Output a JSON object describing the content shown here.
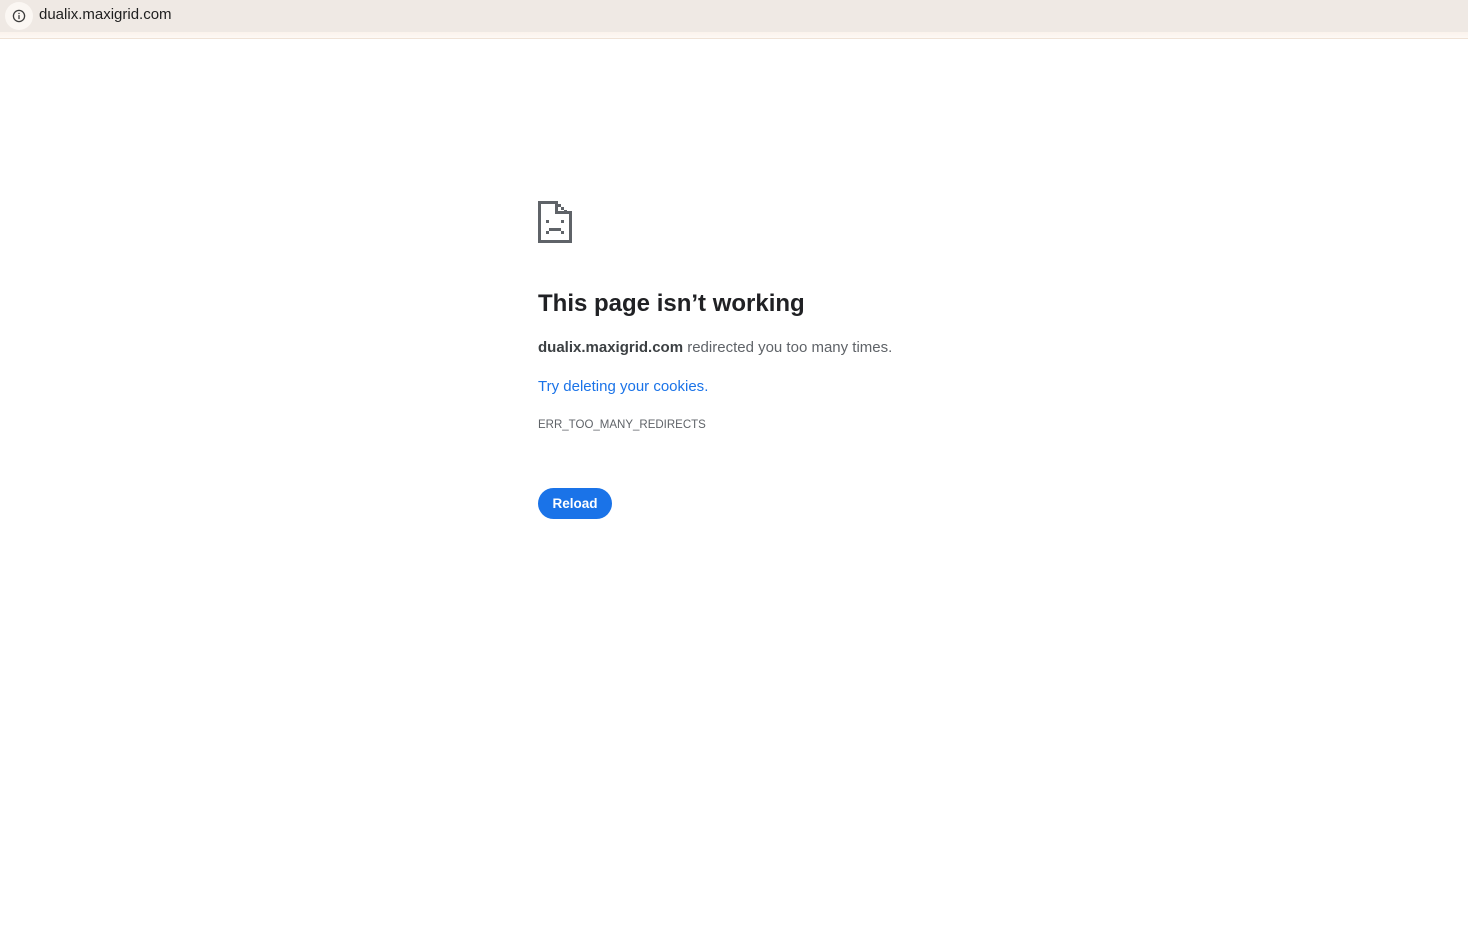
{
  "address_bar": {
    "url": "dualix.maxigrid.com",
    "site_info_icon": "info-circle-icon"
  },
  "error_page": {
    "icon": "sad-page-icon",
    "title": "This page isn’t working",
    "summary_host": "dualix.maxigrid.com",
    "summary_rest": " redirected you too many times.",
    "suggestion_link": "Try deleting your cookies",
    "suggestion_period": ".",
    "error_code": "ERR_TOO_MANY_REDIRECTS",
    "reload_label": "Reload"
  },
  "colors": {
    "accent": "#1a73e8",
    "toolbar_background": "#efe9e4",
    "title_text": "#202124",
    "body_text": "#5f6368"
  }
}
